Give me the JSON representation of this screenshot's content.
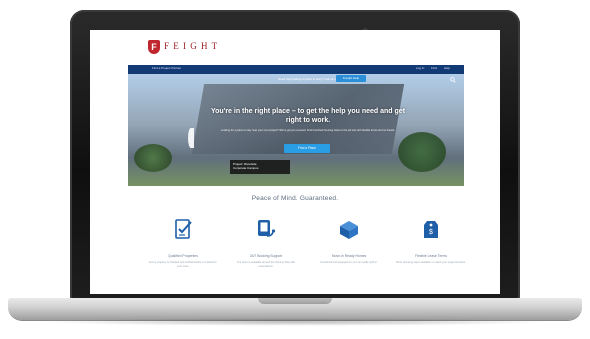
{
  "site": {
    "logo_letter": "F",
    "brand": "F E I G H T",
    "nav_left": "Find a Project Partner",
    "nav_right": [
      "Log In",
      "Find",
      "Help"
    ],
    "phone_text": "Need help finding a place to stay? Call us now!",
    "phone_button": "Freight Help"
  },
  "hero": {
    "headline": "You're in the right place – to get the help you need and get right to work.",
    "subtext": "Looking for a place to stay near your next project? We've got you covered. Find furnished housing close to the job site with flexible terms and no hassle.",
    "cta_label": "Find a Place",
    "banner_line1": "Project: Riverside",
    "banner_line2": "Corporate Campus"
  },
  "section": {
    "title": "Peace of Mind. Guaranteed."
  },
  "features": [
    {
      "label": "Qualified Properties",
      "desc": "Every property is checked and verified before it is listed for your crew."
    },
    {
      "label": "24/7 Booking Support",
      "desc": "Our team is available around the clock to help with reservations."
    },
    {
      "label": "Move-in Ready Homes",
      "desc": "Furnished and equipped so you can settle right in."
    },
    {
      "label": "Flexible Lease Terms",
      "desc": "Short and long stays available to match your project timeline."
    }
  ],
  "colors": {
    "nav_blue": "#123a74",
    "cta_blue": "#2a9ee4",
    "brand_red": "#c0262d",
    "icon_blue": "#1f5fa8"
  },
  "icons": [
    "search-icon",
    "checklist-icon",
    "phone-support-icon",
    "house-box-icon",
    "price-tag-icon"
  ]
}
